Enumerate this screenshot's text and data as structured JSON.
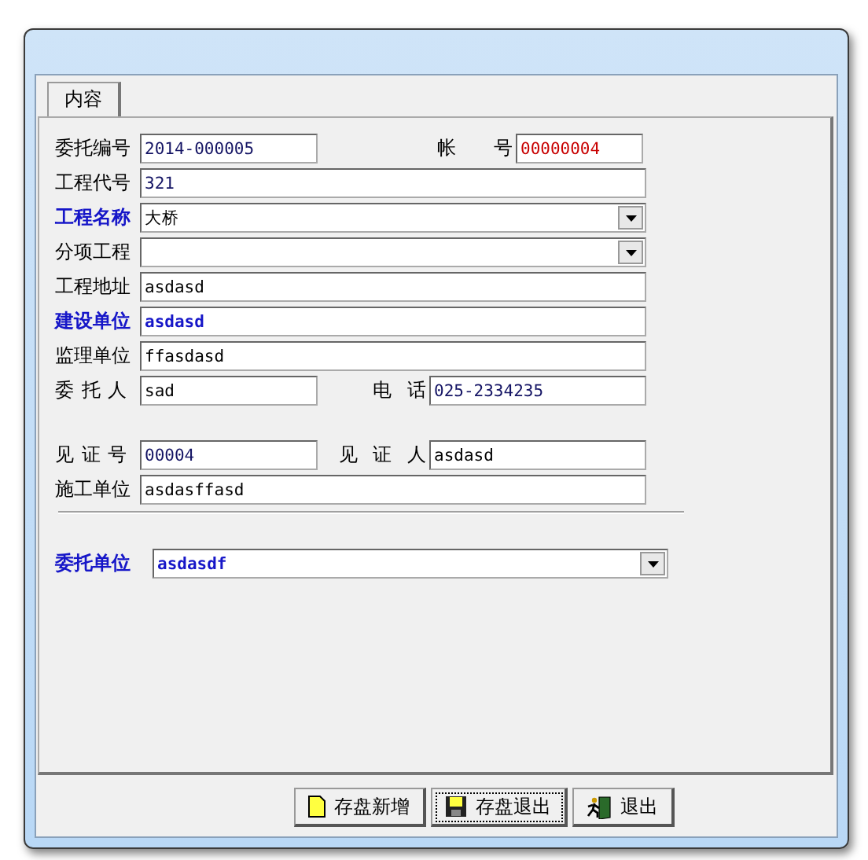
{
  "tabs": [
    {
      "label": "内容",
      "selected": true
    }
  ],
  "sections": [
    {
      "kind": "fields",
      "rows": [
        {
          "fields": [
            {
              "label": "委托编号",
              "value": "2014-000005",
              "kind": "text",
              "label_emphasis": false,
              "color": "#141464",
              "value_bold": false
            },
            {
              "label": "帐 号",
              "value": "00000004",
              "kind": "text",
              "label_emphasis": false,
              "color": "#c80000",
              "value_bold": false
            }
          ]
        },
        {
          "fields": [
            {
              "label": "工程代号",
              "value": "321",
              "kind": "text",
              "label_emphasis": false,
              "color": "#141464",
              "value_bold": false
            }
          ]
        },
        {
          "fields": [
            {
              "label": "工程名称",
              "value": "大桥",
              "kind": "combo",
              "label_emphasis": true,
              "color": "#000000",
              "value_bold": false
            }
          ]
        },
        {
          "fields": [
            {
              "label": "分项工程",
              "kind": "combo",
              "label_emphasis": false
            }
          ]
        },
        {
          "fields": [
            {
              "label": "工程地址",
              "value": "asdasd",
              "kind": "text",
              "label_emphasis": false,
              "color": "#000000",
              "value_bold": false
            }
          ]
        },
        {
          "fields": [
            {
              "label": "建设单位",
              "value": "asdasd",
              "kind": "text",
              "label_emphasis": true,
              "color": "#1616c8",
              "value_bold": true
            }
          ]
        },
        {
          "fields": [
            {
              "label": "监理单位",
              "value": "ffasdasd",
              "kind": "text",
              "label_emphasis": false,
              "color": "#000000",
              "value_bold": false
            }
          ]
        },
        {
          "fields": [
            {
              "label": "委 托 人",
              "value": "sad",
              "kind": "text",
              "label_emphasis": false,
              "color": "#000000",
              "value_bold": false
            },
            {
              "label": "电 话",
              "value": "025-2334235",
              "kind": "text",
              "label_emphasis": false,
              "color": "#141464",
              "value_bold": false
            }
          ]
        }
      ]
    },
    {
      "kind": "fields",
      "rows": [
        {
          "fields": [
            {
              "label": "见 证 号",
              "value": "00004",
              "kind": "text",
              "label_emphasis": false,
              "color": "#141464",
              "value_bold": false
            },
            {
              "label": "见 证 人",
              "value": "asdasd",
              "kind": "text",
              "label_emphasis": false,
              "color": "#000000",
              "value_bold": false
            }
          ]
        },
        {
          "fields": [
            {
              "label": "施工单位",
              "value": "asdasffasd",
              "kind": "text",
              "label_emphasis": false,
              "color": "#000000",
              "value_bold": false
            }
          ]
        }
      ]
    },
    {
      "kind": "separator"
    },
    {
      "kind": "fields",
      "rows": [
        {
          "fields": [
            {
              "label": "委托单位",
              "value": "asdasdf",
              "kind": "combo",
              "label_emphasis": true,
              "color": "#1616c8",
              "value_bold": true
            }
          ]
        }
      ]
    }
  ],
  "buttons": [
    {
      "label": "存盘新增",
      "focused": false
    },
    {
      "label": "存盘退出",
      "focused": true
    },
    {
      "label": "退出",
      "focused": false
    }
  ]
}
